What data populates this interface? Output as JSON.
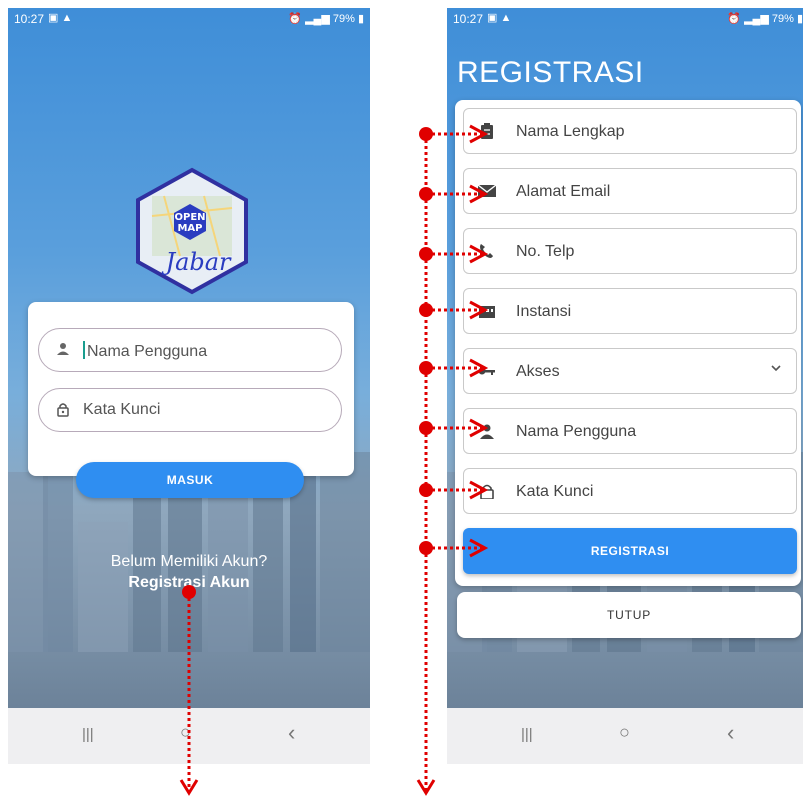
{
  "status_bar": {
    "time": "10:27",
    "battery": "79%"
  },
  "login": {
    "logo_text": {
      "line1": "OPEN",
      "line2": "MAP",
      "script": "Jabar"
    },
    "username_placeholder": "Nama Pengguna",
    "password_placeholder": "Kata Kunci",
    "login_button": "MASUK",
    "no_account_text": "Belum Memiliki Akun?",
    "register_link": "Registrasi Akun"
  },
  "register": {
    "title": "REGISTRASI",
    "fields": [
      {
        "label": "Nama Lengkap",
        "icon": "clipboard-icon"
      },
      {
        "label": "Alamat Email",
        "icon": "mail-icon"
      },
      {
        "label": "No. Telp",
        "icon": "phone-icon"
      },
      {
        "label": "Instansi",
        "icon": "building-icon"
      },
      {
        "label": "Akses",
        "icon": "key-icon"
      },
      {
        "label": "Nama Pengguna",
        "icon": "person-icon"
      },
      {
        "label": "Kata Kunci",
        "icon": "lock-icon"
      }
    ],
    "register_button": "REGISTRASI",
    "close_button": "TUTUP"
  },
  "nav_bar": {
    "recent": "|||",
    "home": "○",
    "back": "‹"
  },
  "colors": {
    "primary_button": "#2f8ef1",
    "annotation_arrow": "#e00000",
    "background_top": "#3f8ed8"
  }
}
